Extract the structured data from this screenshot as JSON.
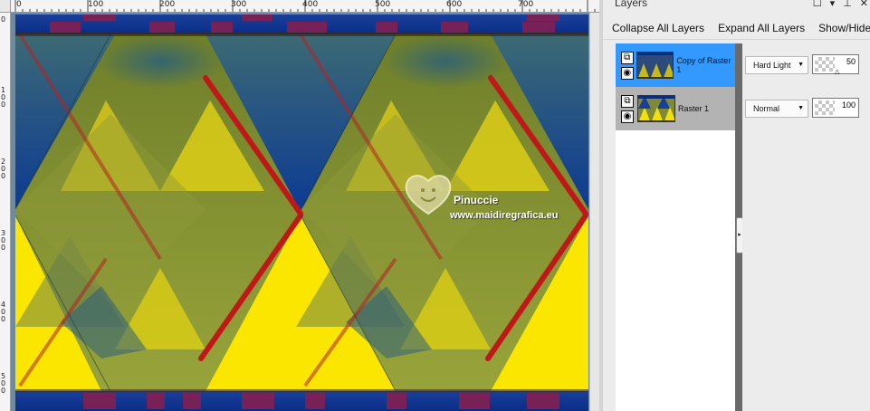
{
  "ruler": {
    "top_labels": [
      "0",
      "100",
      "200",
      "300",
      "400",
      "500",
      "600",
      "700"
    ],
    "left_labels": [
      "0",
      "1\n0\n0",
      "2\n0\n0",
      "3\n0\n0",
      "4\n0\n0",
      "5\n0\n0"
    ]
  },
  "watermark": {
    "line1": "Pinuccie",
    "line2": "www.maidiregrafica.eu"
  },
  "panel": {
    "title": "Layers",
    "toolbar": {
      "collapse_all": "Collapse All Layers",
      "expand_all": "Expand All Layers",
      "show_hide": "Show/Hide Qu"
    },
    "layers": [
      {
        "name": "Copy of Raster 1",
        "blend": "Hard Light",
        "opacity": "50",
        "selected": true
      },
      {
        "name": "Raster 1",
        "blend": "Normal",
        "opacity": "100",
        "selected": false
      }
    ]
  },
  "colors": {
    "selection": "#3399ff",
    "unselected_row": "#b3b3b3",
    "canvas_blue": "#0d3a8f",
    "canvas_yellow": "#f2df10",
    "canvas_red": "#c01818",
    "canvas_olive": "#8d9a3a"
  },
  "icons": [
    "layer-type-icon",
    "visibility-eye-icon",
    "dropdown-arrow-icon",
    "splitter-arrow-icon",
    "panel-menu-icon",
    "pin-icon",
    "close-icon",
    "heart-logo-icon"
  ]
}
